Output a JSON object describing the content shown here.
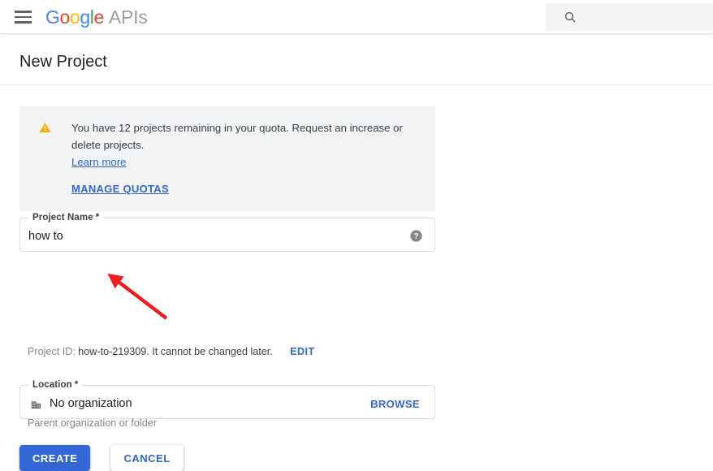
{
  "header": {
    "menu_icon": "hamburger-menu-icon",
    "logo_text": "Google",
    "logo_suffix": "APIs",
    "search": {
      "icon": "search-icon",
      "value": "",
      "placeholder": ""
    }
  },
  "page": {
    "title": "New Project"
  },
  "banner": {
    "icon": "warning-triangle-icon",
    "icon_color": "#F9AB00",
    "background": "#F1F3F4",
    "message": "You have 12 projects remaining in your quota. Request an increase or delete projects.",
    "learn_more_label": "Learn more",
    "manage_quotas_label": "MANAGE QUOTAS",
    "link_color": "#3367D6"
  },
  "form": {
    "project_name": {
      "label": "Project Name",
      "required_marker": "*",
      "value": "how to",
      "placeholder": "",
      "help_icon": "help-circle-icon"
    },
    "project_id": {
      "prefix": "Project ID:",
      "value": "how-to-219309. It cannot be changed later.",
      "edit_label": "EDIT"
    },
    "location": {
      "label": "Location",
      "required_marker": "*",
      "icon": "organization-building-icon",
      "value": "No organization",
      "browse_label": "BROWSE",
      "helper_text": "Parent organization or folder"
    }
  },
  "actions": {
    "create_label": "CREATE",
    "cancel_label": "CANCEL",
    "primary_color": "#3367D6"
  },
  "annotation": {
    "arrow_color": "#EE1C1C",
    "description": "red-arrow-pointing-to-project-id"
  }
}
